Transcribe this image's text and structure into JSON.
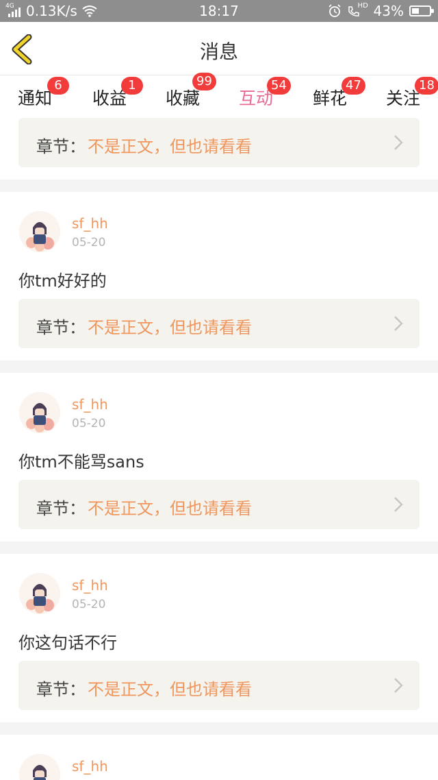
{
  "status_bar": {
    "network_type": "4G",
    "speed": "0.13K/s",
    "time": "18:17",
    "hd_label": "HD",
    "battery": "43%",
    "battery_level": 0.43
  },
  "header": {
    "title": "消息",
    "back_icon": "chevron-left-icon",
    "accent_color": "#f2d32a"
  },
  "tabs": [
    {
      "label": "通知",
      "badge": "6"
    },
    {
      "label": "收益",
      "badge": "1"
    },
    {
      "label": "收藏",
      "badge": "99"
    },
    {
      "label": "互动",
      "badge": "54",
      "active": true
    },
    {
      "label": "鲜花",
      "badge": "47"
    },
    {
      "label": "关注",
      "badge": "18"
    }
  ],
  "colors": {
    "active_tab": "#e86a93",
    "badge": "#f23b3b",
    "username": "#f0965c",
    "chapter_value": "#f0965c"
  },
  "chapter_label": "章节：",
  "cards": [
    {
      "username": "",
      "date": "",
      "comment": "",
      "chapter_label": "章节：",
      "chapter_value": "不是正文，但也请看看"
    },
    {
      "username": "sf_hh",
      "date": "05-20",
      "comment": "你tm好好的",
      "chapter_label": "章节：",
      "chapter_value": "不是正文，但也请看看"
    },
    {
      "username": "sf_hh",
      "date": "05-20",
      "comment": "你tm不能骂sans",
      "chapter_label": "章节：",
      "chapter_value": "不是正文，但也请看看"
    },
    {
      "username": "sf_hh",
      "date": "05-20",
      "comment": "你这句话不行",
      "chapter_label": "章节：",
      "chapter_value": "不是正文，但也请看看"
    },
    {
      "username": "sf_hh",
      "date": "",
      "comment": "",
      "chapter_label": "",
      "chapter_value": ""
    }
  ]
}
